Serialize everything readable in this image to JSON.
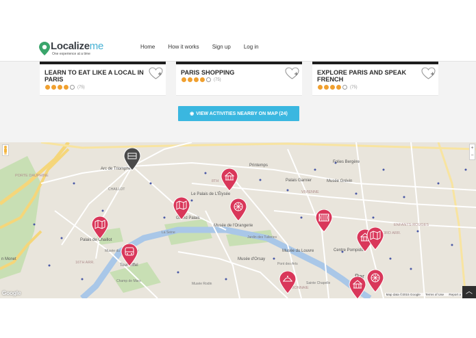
{
  "brand": {
    "name_main": "Localize",
    "name_accent": "me",
    "tagline": "One experience at a time",
    "accent_color": "#46b1d4"
  },
  "nav": {
    "items": [
      {
        "label": "Home"
      },
      {
        "label": "How it works"
      },
      {
        "label": "Sign up"
      },
      {
        "label": "Log in"
      }
    ]
  },
  "activities": [
    {
      "title": "LEARN TO EAT LIKE A LOCAL IN PARIS",
      "rating_filled": 4,
      "rating_total": 5,
      "reviews": "(75)"
    },
    {
      "title": "PARIS SHOPPING",
      "rating_filled": 4,
      "rating_total": 5,
      "reviews": "(75)"
    },
    {
      "title": "EXPLORE PARIS AND SPEAK FRENCH",
      "rating_filled": 4,
      "rating_total": 5,
      "reviews": "(75)"
    }
  ],
  "map_button": {
    "label": "VIEW ACTIVITIES NEARBY ON MAP (24)",
    "icon": "eye-icon",
    "color": "#3ab7e0"
  },
  "map": {
    "labels": {
      "arc": "Arc de Triomphe",
      "chaillot": "CHAILLOT",
      "palais_chaillot": "Palais de Chaillot",
      "elysee": "Le Palais de L'Élysée",
      "grand_palais": "Grand Palais",
      "orangerie": "Musée de l'Orangerie",
      "tuileries": "Jardin des Tuileries",
      "orsay": "Musée d'Orsay",
      "louvre": "Musée du Louvre",
      "pompidou": "Centre Pompidou",
      "eiffel": "Tour Eiffel",
      "champ": "Champ de Mars",
      "garnier": "Palais Garnier",
      "grevin": "Musée Grévin",
      "printemps": "Printemps",
      "folies": "Folies Bergère",
      "vivienne": "VIVIENNE",
      "enfants_rouges": "ENFANTS-ROUGES",
      "arr_16": "16TH ARR.",
      "arr_3": "3RD ARR.",
      "arr_8": "8TH",
      "monnaie": "MONNAIE",
      "seine": "La Seine",
      "rodin": "Musée Rodin",
      "saint_chapelle": "Sainte Chapelle",
      "pont_arts": "Pont des Arts",
      "monet": "n Monet",
      "porte_dauphine": "PORTE DAUPHINE",
      "quai": "Musée du Quai Branly",
      "paris_label": "Par"
    },
    "attribution": "Map data ©2015 Google",
    "terms": "Terms of Use",
    "report": "Report a",
    "google_logo": "Google",
    "zoom_in": "+",
    "zoom_out": "−",
    "pin_color": "#d9375a",
    "selected_pin_color": "#4a4a4a",
    "pins": [
      {
        "icon": "hotel-icon",
        "selected": true
      },
      {
        "icon": "landmark-icon"
      },
      {
        "icon": "map-icon"
      },
      {
        "icon": "ferris-wheel-icon"
      },
      {
        "icon": "map-icon"
      },
      {
        "icon": "bus-icon"
      },
      {
        "icon": "theater-icon"
      },
      {
        "icon": "landmark-icon"
      },
      {
        "icon": "map-icon"
      },
      {
        "icon": "food-icon"
      },
      {
        "icon": "ferris-wheel-icon"
      },
      {
        "icon": "landmark-icon"
      }
    ]
  },
  "scroll_top_icon": "chevron-up-icon"
}
